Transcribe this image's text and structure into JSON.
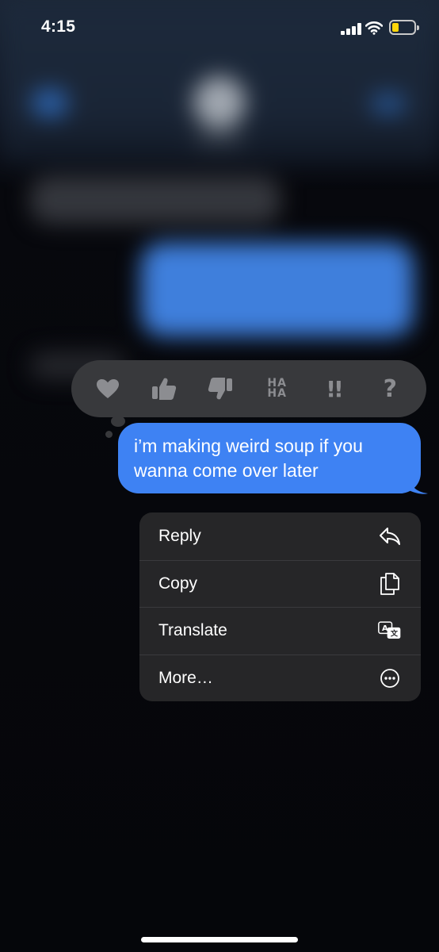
{
  "status_bar": {
    "time": "4:15",
    "battery_color": "#ffd60a"
  },
  "tapbacks": [
    {
      "name": "heart-icon"
    },
    {
      "name": "thumbs-up-icon"
    },
    {
      "name": "thumbs-down-icon"
    },
    {
      "name": "haha-icon",
      "line1": "HA",
      "line2": "HA"
    },
    {
      "name": "exclamation-icon",
      "text": "!!"
    },
    {
      "name": "question-icon",
      "text": "?"
    }
  ],
  "message": {
    "text": "i’m making weird soup if you wanna come over later",
    "bubble_color": "#3e82f3"
  },
  "menu": {
    "items": [
      {
        "label": "Reply",
        "icon": "reply-icon"
      },
      {
        "label": "Copy",
        "icon": "copy-icon"
      },
      {
        "label": "Translate",
        "icon": "translate-icon"
      },
      {
        "label": "More…",
        "icon": "more-icon"
      }
    ]
  }
}
